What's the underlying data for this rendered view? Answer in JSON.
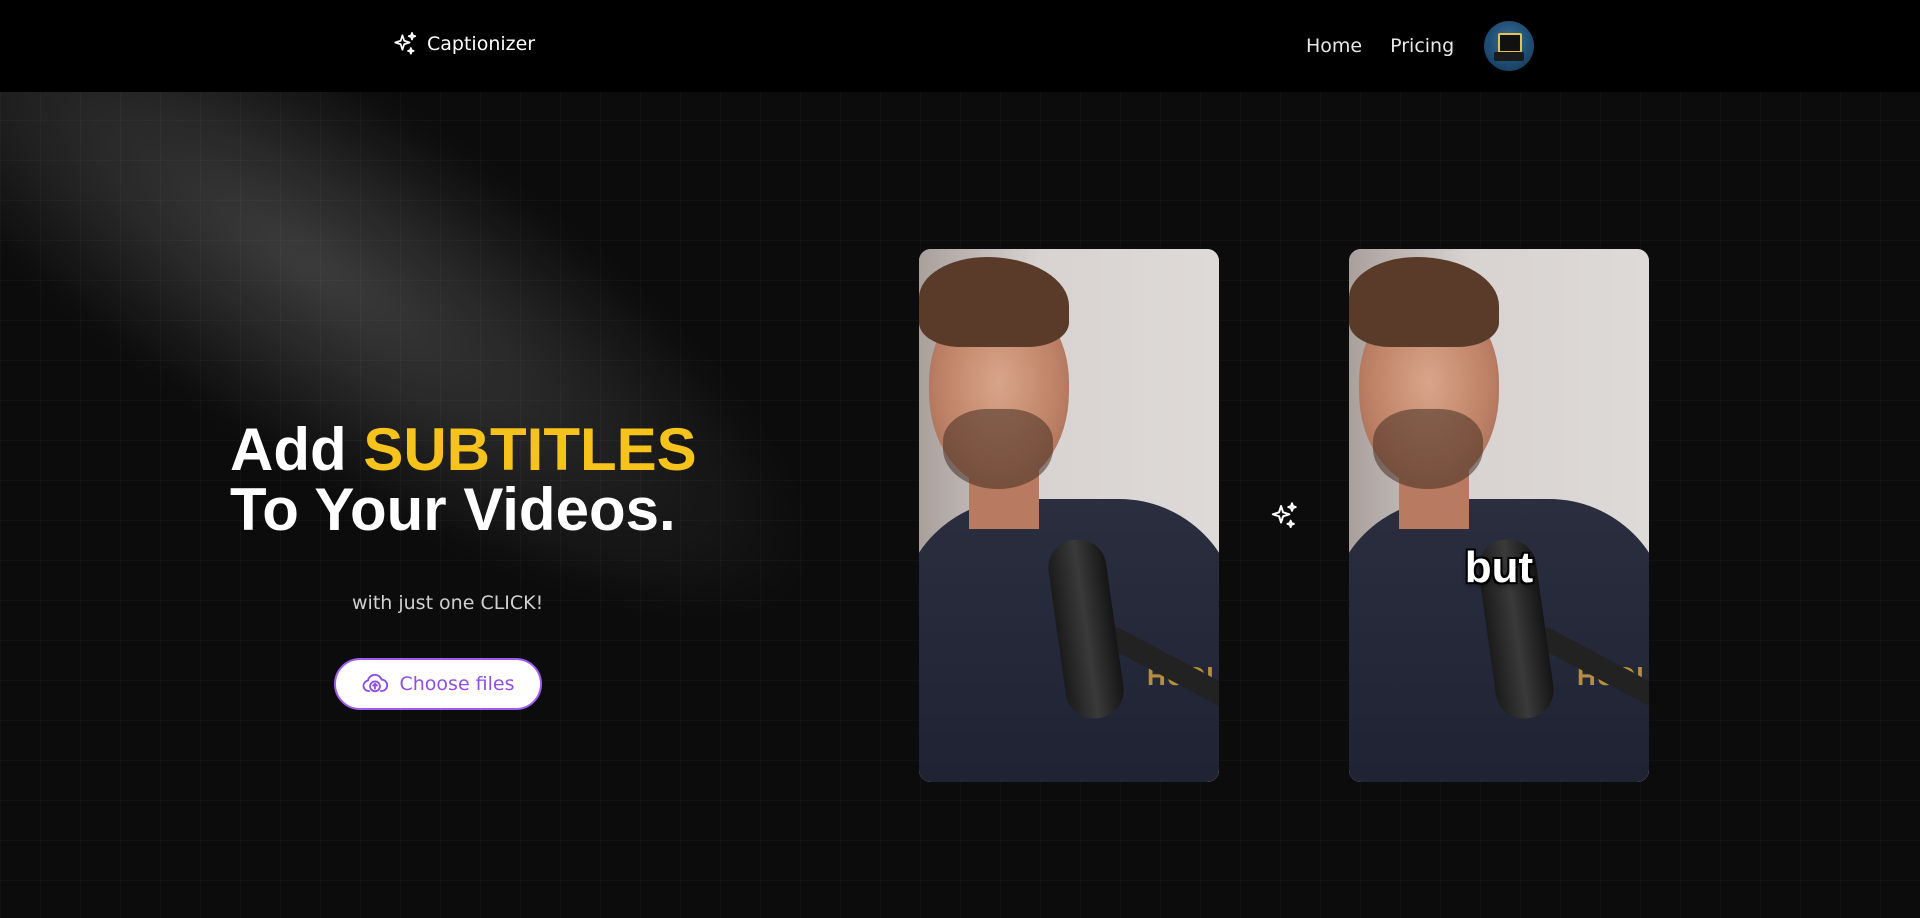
{
  "header": {
    "brand": "Captionizer",
    "nav": {
      "home": "Home",
      "pricing": "Pricing"
    }
  },
  "hero": {
    "title_prefix": "Add ",
    "title_accent": "SUBTITLES",
    "title_line2": "To Your Videos.",
    "tagline": "with just one CLICK!",
    "upload_button": "Choose files"
  },
  "preview": {
    "caption_word": "but"
  },
  "icons": {
    "brand": "sparkles-icon",
    "upload": "cloud-upload-icon",
    "transform": "sparkles-icon"
  },
  "colors": {
    "accent_yellow": "#f6c21c",
    "button_purple": "#a05cf2",
    "background": "#0c0c0c",
    "header": "#000000"
  }
}
